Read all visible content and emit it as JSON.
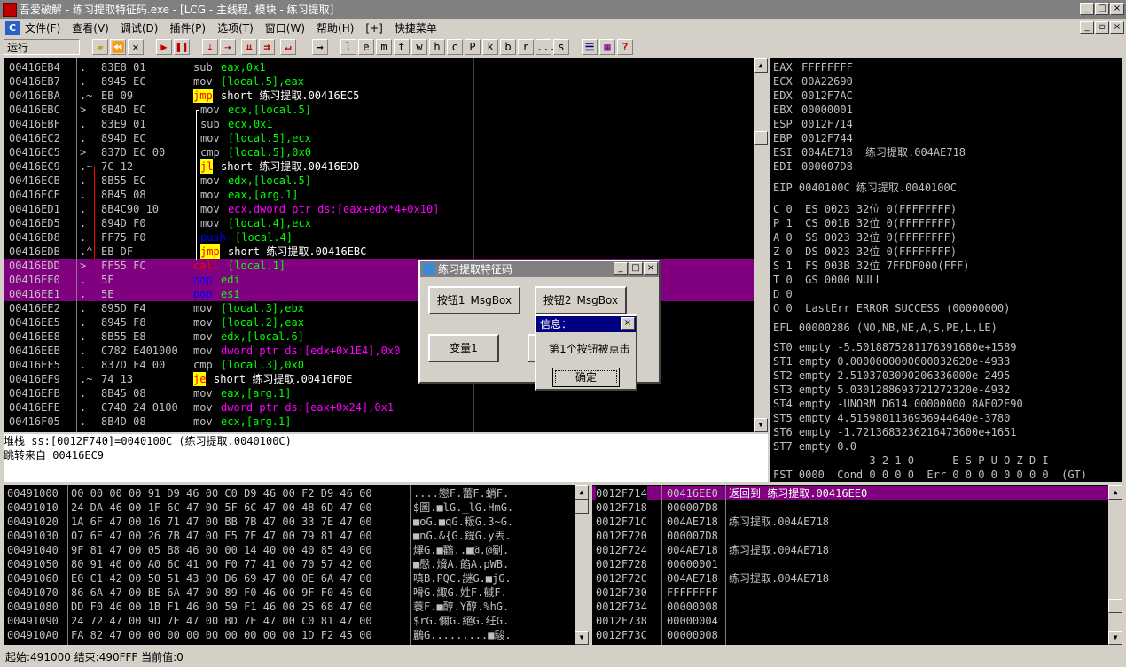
{
  "window": {
    "title": "吾爱破解 - 练习提取特征码.exe - [LCG - 主线程, 模块 - 练习提取]"
  },
  "menu": {
    "items": [
      "文件(F)",
      "查看(V)",
      "调试(D)",
      "插件(P)",
      "选项(T)",
      "窗口(W)",
      "帮助(H)",
      "[+]",
      "快捷菜单"
    ]
  },
  "toolbar": {
    "state": "运行",
    "letters": [
      "l",
      "e",
      "m",
      "t",
      "w",
      "h",
      "c",
      "P",
      "k",
      "b",
      "r",
      "...",
      "s"
    ]
  },
  "disasm": {
    "rows": [
      {
        "addr": "00416EB4",
        "mark": ".",
        "hex": "83E8 01",
        "mn": "sub",
        "ops": "eax,0x1",
        "sel": false
      },
      {
        "addr": "00416EB7",
        "mark": ".",
        "hex": "8945 EC",
        "mn": "mov",
        "ops": "[local.5],eax",
        "sel": false
      },
      {
        "addr": "00416EBA",
        "mark": ".~",
        "hex": "EB 09",
        "mn": "jmp",
        "ops": "short 练习提取.00416EC5",
        "sel": false
      },
      {
        "addr": "00416EBC",
        "mark": ">",
        "hex": "8B4D EC",
        "mn": "mov",
        "ops": "ecx,[local.5]",
        "sel": false
      },
      {
        "addr": "00416EBF",
        "mark": ".",
        "hex": "83E9 01",
        "mn": "sub",
        "ops": "ecx,0x1",
        "sel": false
      },
      {
        "addr": "00416EC2",
        "mark": ".",
        "hex": "894D EC",
        "mn": "mov",
        "ops": "[local.5],ecx",
        "sel": false
      },
      {
        "addr": "00416EC5",
        "mark": ">",
        "hex": "837D EC 00",
        "mn": "cmp",
        "ops": "[local.5],0x0",
        "sel": false
      },
      {
        "addr": "00416EC9",
        "mark": ".~",
        "hex": "7C 12",
        "mn": "jl",
        "ops": "short 练习提取.00416EDD",
        "sel": false
      },
      {
        "addr": "00416ECB",
        "mark": ".",
        "hex": "8B55 EC",
        "mn": "mov",
        "ops": "edx,[local.5]",
        "sel": false
      },
      {
        "addr": "00416ECE",
        "mark": ".",
        "hex": "8B45 08",
        "mn": "mov",
        "ops": "eax,[arg.1]",
        "sel": false
      },
      {
        "addr": "00416ED1",
        "mark": ".",
        "hex": "8B4C90 10",
        "mn": "mov",
        "ops": "ecx,dword ptr ds:[eax+edx*4+0x10]",
        "sel": false
      },
      {
        "addr": "00416ED5",
        "mark": ".",
        "hex": "894D F0",
        "mn": "mov",
        "ops": "[local.4],ecx",
        "sel": false
      },
      {
        "addr": "00416ED8",
        "mark": ".",
        "hex": "FF75 F0",
        "mn": "push",
        "ops": "[local.4]",
        "sel": false
      },
      {
        "addr": "00416EDB",
        "mark": ".^",
        "hex": "EB DF",
        "mn": "jmp",
        "ops": "short 练习提取.00416EBC",
        "sel": false
      },
      {
        "addr": "00416EDD",
        "mark": ">",
        "hex": "FF55 FC",
        "mn": "call",
        "ops": "[local.1]",
        "sel": true
      },
      {
        "addr": "00416EE0",
        "mark": ".",
        "hex": "5F",
        "mn": "pop",
        "ops": "edi",
        "sel": true
      },
      {
        "addr": "00416EE1",
        "mark": ".",
        "hex": "5E",
        "mn": "pop",
        "ops": "esi",
        "sel": true
      },
      {
        "addr": "00416EE2",
        "mark": ".",
        "hex": "895D F4",
        "mn": "mov",
        "ops": "[local.3],ebx",
        "sel": false
      },
      {
        "addr": "00416EE5",
        "mark": ".",
        "hex": "8945 F8",
        "mn": "mov",
        "ops": "[local.2],eax",
        "sel": false
      },
      {
        "addr": "00416EE8",
        "mark": ".",
        "hex": "8B55 E8",
        "mn": "mov",
        "ops": "edx,[local.6]",
        "sel": false
      },
      {
        "addr": "00416EEB",
        "mark": ".",
        "hex": "C782 E401000",
        "mn": "mov",
        "ops": "dword ptr ds:[edx+0x1E4],0x0",
        "sel": false
      },
      {
        "addr": "00416EF5",
        "mark": ".",
        "hex": "837D F4 00",
        "mn": "cmp",
        "ops": "[local.3],0x0",
        "sel": false
      },
      {
        "addr": "00416EF9",
        "mark": ".~",
        "hex": "74 13",
        "mn": "je",
        "ops": "short 练习提取.00416F0E",
        "sel": false
      },
      {
        "addr": "00416EFB",
        "mark": ".",
        "hex": "8B45 08",
        "mn": "mov",
        "ops": "eax,[arg.1]",
        "sel": false
      },
      {
        "addr": "00416EFE",
        "mark": ".",
        "hex": "C740 24 0100",
        "mn": "mov",
        "ops": "dword ptr ds:[eax+0x24],0x1",
        "sel": false
      },
      {
        "addr": "00416F05",
        "mark": ".",
        "hex": "8B4D 08",
        "mn": "mov",
        "ops": "ecx,[arg.1]",
        "sel": false
      }
    ]
  },
  "info": {
    "line1": "堆栈 ss:[0012F740]=0040100C (练习提取.0040100C)",
    "line2": "跳转来自 00416EC9"
  },
  "registers": {
    "gp": [
      {
        "name": "EAX",
        "val": "FFFFFFFF",
        "note": ""
      },
      {
        "name": "ECX",
        "val": "00A22690",
        "note": ""
      },
      {
        "name": "EDX",
        "val": "0012F7AC",
        "note": ""
      },
      {
        "name": "EBX",
        "val": "00000001",
        "note": ""
      },
      {
        "name": "ESP",
        "val": "0012F714",
        "note": ""
      },
      {
        "name": "EBP",
        "val": "0012F744",
        "note": ""
      },
      {
        "name": "ESI",
        "val": "004AE718",
        "note": "练习提取.004AE718"
      },
      {
        "name": "EDI",
        "val": "000007D8",
        "note": ""
      }
    ],
    "eip": "EIP 0040100C 练习提取.0040100C",
    "flags": [
      "C 0  ES 0023 32位 0(FFFFFFFF)",
      "P 1  CS 001B 32位 0(FFFFFFFF)",
      "A 0  SS 0023 32位 0(FFFFFFFF)",
      "Z 0  DS 0023 32位 0(FFFFFFFF)",
      "S 1  FS 003B 32位 7FFDF000(FFF)",
      "T 0  GS 0000 NULL",
      "D 0",
      "O 0  LastErr ERROR_SUCCESS (00000000)"
    ],
    "efl": "EFL 00000286 (NO,NB,NE,A,S,PE,L,LE)",
    "fpu": [
      "ST0 empty -5.5018875281176391680e+1589",
      "ST1 empty 0.0000000000000032620e-4933",
      "ST2 empty 2.5103703090206336000e-2495",
      "ST3 empty 5.0301288693721272320e-4932",
      "ST4 empty -UNORM D614 00000000 8AE02E90",
      "ST5 empty 4.5159801136936944640e-3780",
      "ST6 empty -1.7213683236216473600e+1651",
      "ST7 empty 0.0"
    ],
    "fst_head": "               3 2 1 0      E S P U O Z D I",
    "fst": "FST 0000  Cond 0 0 0 0  Err 0 0 0 0 0 0 0 0  (GT)"
  },
  "dump": {
    "rows": [
      {
        "addr": "00491000",
        "hex": "00 00 00 00 91 D9 46 00 C0 D9 46 00 F2 D9 46 00",
        "asc": "....戀F.蕾F.蛸F."
      },
      {
        "addr": "00491010",
        "hex": "24 DA 46 00 1F 6C 47 00 5F 6C 47 00 48 6D 47 00",
        "asc": "$圖.■lG._lG.HmG."
      },
      {
        "addr": "00491020",
        "hex": "1A 6F 47 00 16 71 47 00 BB 7B 47 00 33 7E 47 00",
        "asc": "■oG.■qG.粄G.3~G."
      },
      {
        "addr": "00491030",
        "hex": "07 6E 47 00 26 7B 47 00 E5 7E 47 00 79 81 47 00",
        "asc": "■nG.&{G.鍉G.y丟."
      },
      {
        "addr": "00491040",
        "hex": "9F 81 47 00 05 B8 46 00 00 14 40 00 40 85 40 00",
        "asc": "熚G.■鸐..■@.@劅."
      },
      {
        "addr": "00491050",
        "hex": "80 91 40 00 A0 6C 41 00 F0 77 41 00 70 57 42 00",
        "asc": "■慇.燲A.餡A.pWB."
      },
      {
        "addr": "00491060",
        "hex": "E0 C1 42 00 50 51 43 00 D6 69 47 00 0E 6A 47 00",
        "asc": "嗔B.PQC.謎G.■jG."
      },
      {
        "addr": "00491070",
        "hex": "86 6A 47 00 BE 6A 47 00 89 F0 46 00 9F F0 46 00",
        "asc": "嗗G.緅G.姓F.戫F."
      },
      {
        "addr": "00491080",
        "hex": "DD F0 46 00 1B F1 46 00 59 F1 46 00 25 68 47 00",
        "asc": "蓑F.■醇.Y醇.%hG."
      },
      {
        "addr": "00491090",
        "hex": "24 72 47 00 9D 7E 47 00 BD 7E 47 00 C0 81 47 00",
        "asc": "$rG.儞G.絕G.纴G."
      },
      {
        "addr": "004910A0",
        "hex": "FA 82 47 00 00 00 00 00 00 00 00 00 1D F2 45 00",
        "asc": "鸝G.........■駿."
      }
    ]
  },
  "stack": {
    "rows": [
      {
        "addr": "0012F714",
        "val": "00416EE0",
        "cmt": "返回到 练习提取.00416EE0",
        "sel": true
      },
      {
        "addr": "0012F718",
        "val": "000007D8",
        "cmt": "",
        "sel": false
      },
      {
        "addr": "0012F71C",
        "val": "004AE718",
        "cmt": "练习提取.004AE718",
        "sel": false
      },
      {
        "addr": "0012F720",
        "val": "000007D8",
        "cmt": "",
        "sel": false
      },
      {
        "addr": "0012F724",
        "val": "004AE718",
        "cmt": "练习提取.004AE718",
        "sel": false
      },
      {
        "addr": "0012F728",
        "val": "00000001",
        "cmt": "",
        "sel": false
      },
      {
        "addr": "0012F72C",
        "val": "004AE718",
        "cmt": "练习提取.004AE718",
        "sel": false
      },
      {
        "addr": "0012F730",
        "val": "FFFFFFFF",
        "cmt": "",
        "sel": false
      },
      {
        "addr": "0012F734",
        "val": "00000008",
        "cmt": "",
        "sel": false
      },
      {
        "addr": "0012F738",
        "val": "00000004",
        "cmt": "",
        "sel": false
      },
      {
        "addr": "0012F73C",
        "val": "00000008",
        "cmt": "",
        "sel": false
      }
    ]
  },
  "dialog": {
    "title": "练习提取特征码",
    "btn1": "按钮1_MsgBox",
    "btn2": "按钮2_MsgBox",
    "btn3": "变量1"
  },
  "msgbox": {
    "title": "信息：",
    "text": "第1个按钮被点击",
    "ok": "确定"
  },
  "status": {
    "text": "起始:491000 结束:490FFF 当前值:0"
  },
  "colors": {
    "selected": "#800080",
    "pane_bg": "#000000",
    "caption_active": "#000080",
    "caption_inactive": "#808080"
  }
}
